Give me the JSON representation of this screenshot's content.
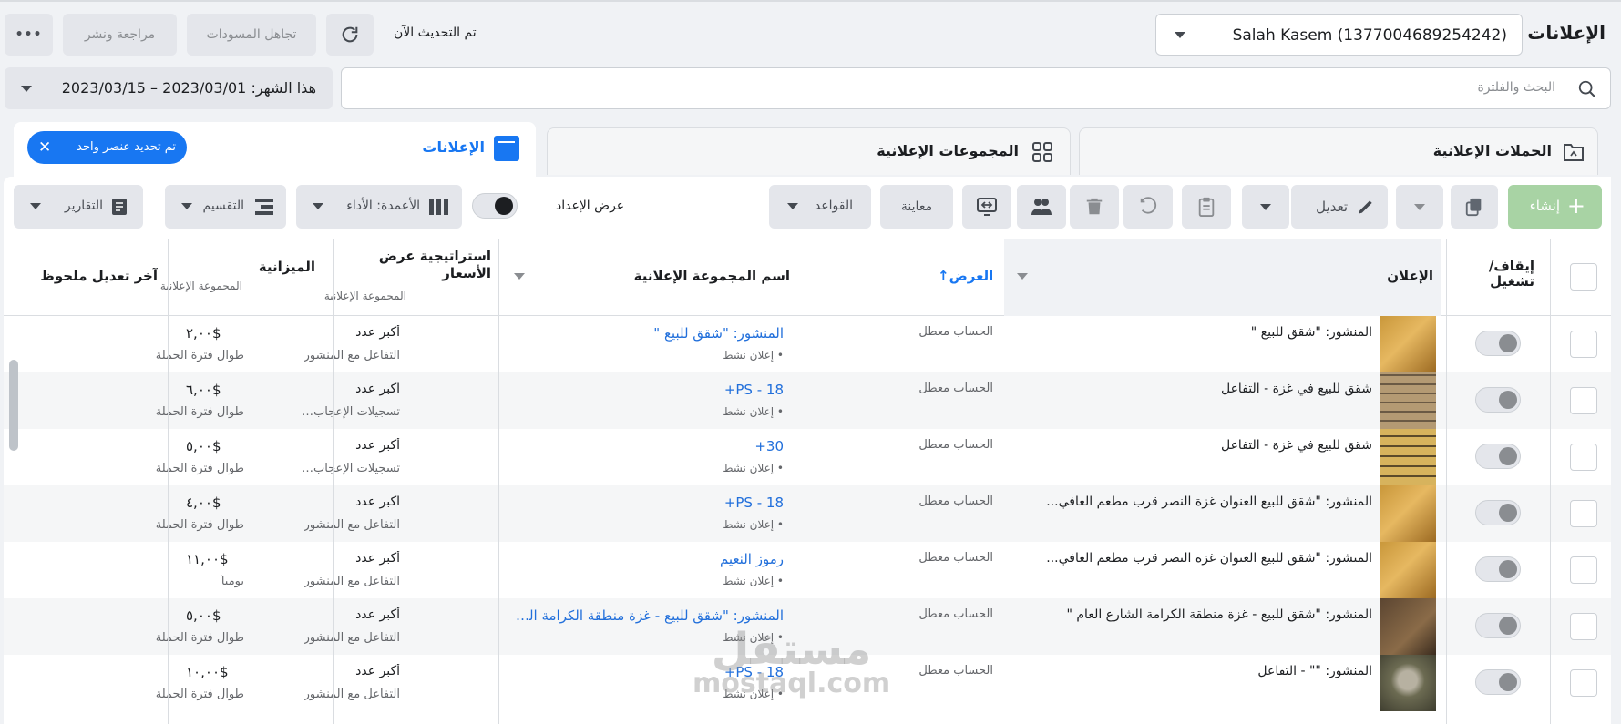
{
  "top": {
    "title": "الإعلانات",
    "account": "Salah Kasem (1377004689254242)",
    "updated_text": "تم التحديث الآن",
    "discard_drafts": "تجاهل المسودات",
    "review_publish": "مراجعة ونشر",
    "more": "•••"
  },
  "search": {
    "placeholder": "البحث والفلترة",
    "date_range": "هذا الشهر: 2023/03/01 – 2023/03/15"
  },
  "tabs": {
    "campaigns": "الحملات الإعلانية",
    "adsets": "المجموعات الإعلانية",
    "ads": "الإعلانات",
    "selected_chip": "تم تحديد عنصر واحد"
  },
  "toolbar": {
    "create": "إنشاء",
    "edit": "تعديل",
    "rules": "القواعد",
    "preview": "معاينة",
    "setup_toggle": "عرض الإعداد",
    "columns": "الأعمدة: الأداء",
    "breakdown": "التقسيم",
    "reports": "التقارير"
  },
  "columns": {
    "onoff": "إيقاف/ تشغيل",
    "ad": "الإعلان",
    "delivery": "العرض",
    "adset_name": "اسم المجموعة الإعلانية",
    "bid_strategy": "استراتيجية عرض الأسعار",
    "bid_strategy_sub": "المجموعة الإعلانية",
    "budget": "الميزانية",
    "budget_sub": "المجموعة الإعلانية",
    "last_edit": "آخر تعديل ملحوظ"
  },
  "rows": [
    {
      "ad": "المنشور: \"شقق للبيع \"",
      "delivery": "الحساب معطّل",
      "adset": "المنشور: \"شقق للبيع \"",
      "adset_sub": "• إعلان نشط",
      "bid": "أكبر عدد",
      "bid_sub": "التفاعل مع المنشور",
      "budget": "٢,٠٠$",
      "budget_sub": "طوال فترة الحملة",
      "thumb": "wood"
    },
    {
      "ad": "شقق للبيع في غزة - التفاعل",
      "delivery": "الحساب معطّل",
      "adset": "PS - 18+",
      "adset_sub": "• إعلان نشط",
      "bid": "أكبر عدد",
      "bid_sub": "تسجيلات الإعجاب بالصـ...",
      "budget": "٦,٠٠$",
      "budget_sub": "طوال فترة الحملة",
      "thumb": "building"
    },
    {
      "ad": "شقق للبيع في غزة - التفاعل",
      "delivery": "الحساب معطّل",
      "adset": "30+",
      "adset_sub": "• إعلان نشط",
      "bid": "أكبر عدد",
      "bid_sub": "تسجيلات الإعجاب بالصـ...",
      "budget": "٥,٠٠$",
      "budget_sub": "طوال فترة الحملة",
      "thumb": "building2"
    },
    {
      "ad": "المنشور: \"شقق للبيع العنوان غزة النصر قرب مطعم العافي...",
      "delivery": "الحساب معطّل",
      "adset": "PS - 18+",
      "adset_sub": "• إعلان نشط",
      "bid": "أكبر عدد",
      "bid_sub": "التفاعل مع المنشور",
      "budget": "٤,٠٠$",
      "budget_sub": "طوال فترة الحملة",
      "thumb": "wood"
    },
    {
      "ad": "المنشور: \"شقق للبيع العنوان غزة النصر قرب مطعم العافي...",
      "delivery": "الحساب معطّل",
      "adset": "رموز النعيم",
      "adset_sub": "• إعلان نشط",
      "bid": "أكبر عدد",
      "bid_sub": "التفاعل مع المنشور",
      "budget": "١١,٠٠$",
      "budget_sub": "يومياً",
      "thumb": "wood"
    },
    {
      "ad": "المنشور: \"شقق للبيع - غزة منطقة الكرامة الشارع العام \"",
      "delivery": "الحساب معطّل",
      "adset": "المنشور: \"شقق للبيع - غزة منطقة الكرامة الشا...",
      "adset_sub": "• إعلان نشط",
      "bid": "أكبر عدد",
      "bid_sub": "التفاعل مع المنشور",
      "budget": "٥,٠٠$",
      "budget_sub": "طوال فترة الحملة",
      "thumb": "dark"
    },
    {
      "ad": "المنشور: \"\" - التفاعل",
      "delivery": "الحساب معطّل",
      "adset": "PS - 18+",
      "adset_sub": "• إعلان نشط",
      "bid": "أكبر عدد",
      "bid_sub": "التفاعل مع المنشور",
      "budget": "١٠,٠٠$",
      "budget_sub": "طوال فترة الحملة",
      "thumb": "stone"
    }
  ],
  "watermark": {
    "line1": "مستقل",
    "line2": "mostaql.com"
  }
}
